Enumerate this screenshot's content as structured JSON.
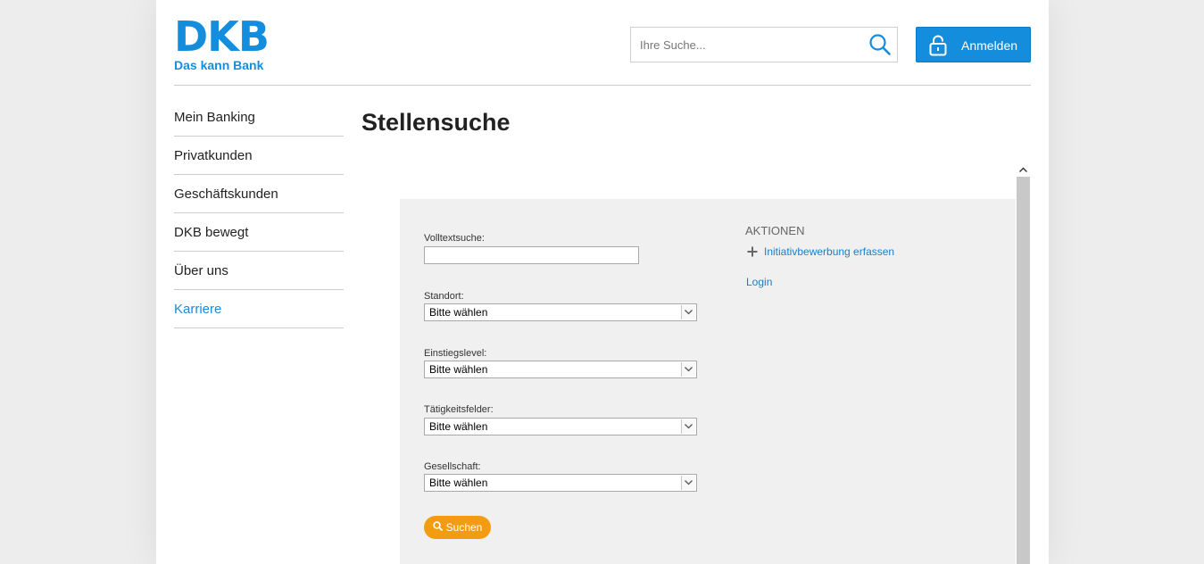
{
  "brand": {
    "name": "DKB",
    "claim": "Das kann Bank",
    "color": "#148ddd"
  },
  "header": {
    "search_placeholder": "Ihre Suche...",
    "search_icon": "search-icon",
    "login_label": "Anmelden",
    "login_icon": "lock-icon"
  },
  "sidebar": {
    "items": [
      {
        "label": "Mein Banking"
      },
      {
        "label": "Privatkunden"
      },
      {
        "label": "Geschäftskunden"
      },
      {
        "label": "DKB bewegt"
      },
      {
        "label": "Über uns"
      },
      {
        "label": "Karriere",
        "active": true
      }
    ]
  },
  "main": {
    "title": "Stellensuche"
  },
  "job_search": {
    "fulltext_label": "Volltextsuche:",
    "fulltext_value": "",
    "filters": [
      {
        "label": "Standort:",
        "value": "Bitte wählen"
      },
      {
        "label": "Einstiegslevel:",
        "value": "Bitte wählen"
      },
      {
        "label": "Tätigkeitsfelder:",
        "value": "Bitte wählen"
      },
      {
        "label": "Gesellschaft:",
        "value": "Bitte wählen"
      }
    ],
    "submit_label": "Suchen",
    "submit_color": "#f39c12"
  },
  "actions": {
    "title": "AKTIONEN",
    "initiative_label": "Initiativbewerbung erfassen",
    "login_label": "Login"
  }
}
